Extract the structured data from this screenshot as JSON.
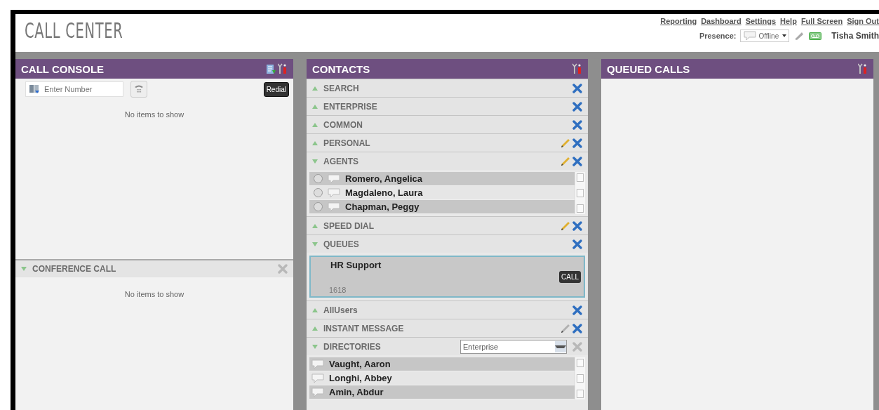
{
  "header": {
    "logo": "CALL CENTER",
    "links": [
      "Reporting",
      "Dashboard",
      "Settings",
      "Help",
      "Full Screen",
      "Sign Out"
    ],
    "presence_label": "Presence:",
    "presence_status": "Offline",
    "user": "Tisha Smith"
  },
  "call_console": {
    "title": "CALL CONSOLE",
    "number_placeholder": "Enter Number",
    "redial": "Redial",
    "empty": "No items to show"
  },
  "conference_call": {
    "title": "CONFERENCE CALL",
    "expanded": true,
    "close_enabled": false,
    "empty": "No items to show"
  },
  "contacts": {
    "title": "CONTACTS",
    "sections": [
      {
        "title": "SEARCH",
        "expanded": false,
        "close_enabled": true
      },
      {
        "title": "ENTERPRISE",
        "expanded": false,
        "close_enabled": true
      },
      {
        "title": "COMMON",
        "expanded": false,
        "close_enabled": true
      },
      {
        "title": "PERSONAL",
        "expanded": false,
        "edit_enabled": true,
        "close_enabled": true
      },
      {
        "title": "AGENTS",
        "expanded": true,
        "edit_enabled": true,
        "close_enabled": true,
        "kind": "agents",
        "agents": [
          {
            "name": "Romero, Angelica",
            "selected": false
          },
          {
            "name": "Magdaleno, Laura",
            "selected": false
          },
          {
            "name": "Chapman, Peggy",
            "selected": false
          }
        ]
      },
      {
        "title": "SPEED DIAL",
        "expanded": false,
        "edit_enabled": true,
        "close_enabled": true
      },
      {
        "title": "QUEUES",
        "expanded": true,
        "close_enabled": true,
        "kind": "queues",
        "queues": [
          {
            "name": "HR Support",
            "number": "1618",
            "call": "CALL"
          }
        ]
      },
      {
        "title": "AllUsers",
        "expanded": false,
        "close_enabled": true
      },
      {
        "title": "INSTANT MESSAGE",
        "expanded": false,
        "edit_enabled": false,
        "close_enabled": true
      },
      {
        "title": "DIRECTORIES",
        "expanded": true,
        "close_enabled": false,
        "kind": "directory",
        "source": "Enterprise",
        "entries": [
          {
            "name": "Vaught, Aaron"
          },
          {
            "name": "Longhi, Abbey"
          },
          {
            "name": "Amin, Abdur"
          }
        ]
      }
    ]
  },
  "queued_calls": {
    "title": "QUEUED CALLS"
  }
}
